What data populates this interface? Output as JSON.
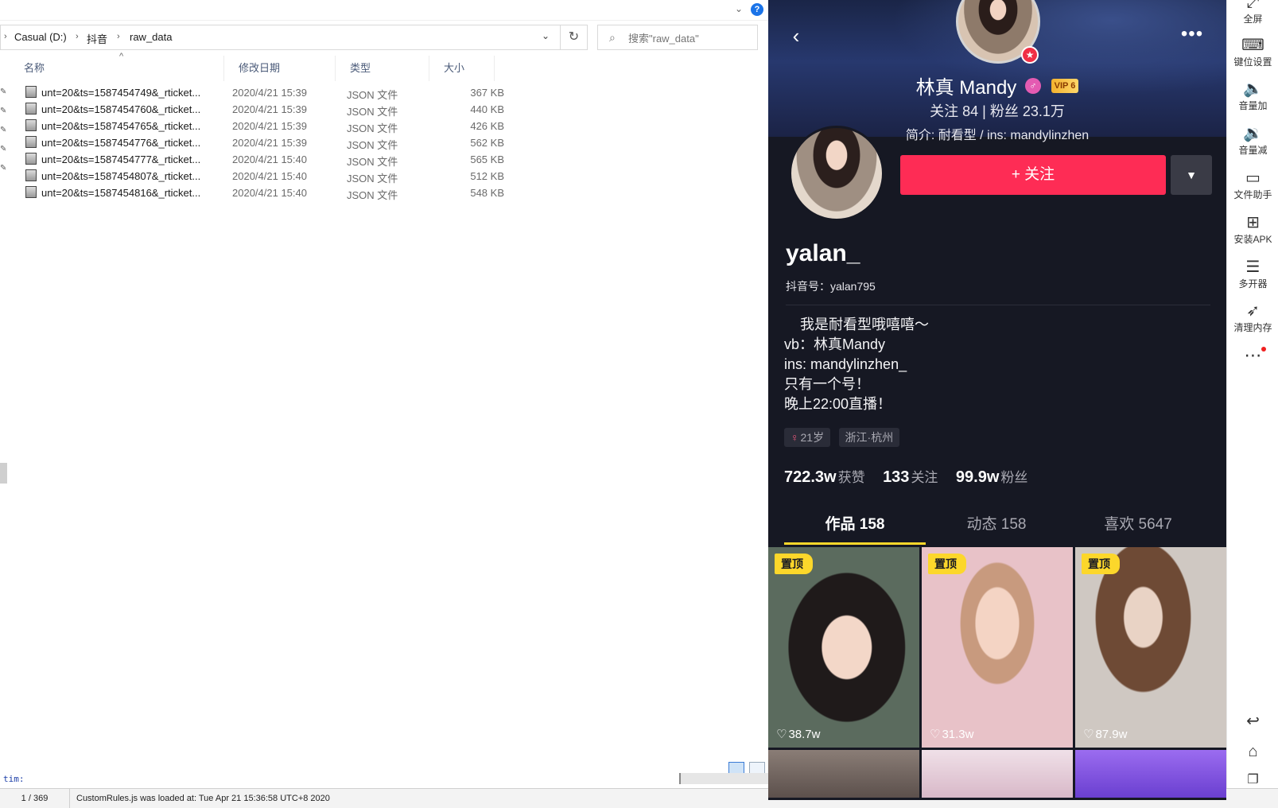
{
  "explorer": {
    "breadcrumb": [
      "Casual (D:)",
      "抖音",
      "raw_data"
    ],
    "search_placeholder": "搜索\"raw_data\"",
    "columns": {
      "name": "名称",
      "date": "修改日期",
      "type": "类型",
      "size": "大小"
    },
    "files": [
      {
        "name": "unt=20&ts=1587454749&_rticket...",
        "date": "2020/4/21 15:39",
        "type": "JSON 文件",
        "size": "367 KB"
      },
      {
        "name": "unt=20&ts=1587454760&_rticket...",
        "date": "2020/4/21 15:39",
        "type": "JSON 文件",
        "size": "440 KB"
      },
      {
        "name": "unt=20&ts=1587454765&_rticket...",
        "date": "2020/4/21 15:39",
        "type": "JSON 文件",
        "size": "426 KB"
      },
      {
        "name": "unt=20&ts=1587454776&_rticket...",
        "date": "2020/4/21 15:39",
        "type": "JSON 文件",
        "size": "562 KB"
      },
      {
        "name": "unt=20&ts=1587454777&_rticket...",
        "date": "2020/4/21 15:40",
        "type": "JSON 文件",
        "size": "565 KB"
      },
      {
        "name": "unt=20&ts=1587454807&_rticket...",
        "date": "2020/4/21 15:40",
        "type": "JSON 文件",
        "size": "512 KB"
      },
      {
        "name": "unt=20&ts=1587454816&_rticket...",
        "date": "2020/4/21 15:40",
        "type": "JSON 文件",
        "size": "548 KB"
      }
    ],
    "tim_label": "tim:"
  },
  "status_bar": {
    "count": "1 / 369",
    "message": "CustomRules.js was loaded at: Tue Apr 21 15:36:58 UTC+8 2020"
  },
  "phone": {
    "header": {
      "name": "林真 Mandy",
      "vip": "VIP 6",
      "stats_line": "关注  84   |   粉丝  23.1万",
      "bio_line": "简介: 耐看型 / ins: mandylinzhen"
    },
    "profile": {
      "follow_label": "+ 关注",
      "username": "yalan_",
      "douyin_id": "抖音号：yalan795",
      "bio": "    我是耐看型哦嘻嘻～\nvb：林真Mandy\nins: mandylinzhen_\n只有一个号！\n晚上22:00直播！",
      "tags": {
        "age": "21岁",
        "location": "浙江·杭州"
      },
      "stats": {
        "likes": {
          "num": "722.3w",
          "label": "获赞"
        },
        "following": {
          "num": "133",
          "label": "关注"
        },
        "followers": {
          "num": "99.9w",
          "label": "粉丝"
        }
      },
      "tabs": [
        "作品 158",
        "动态 158",
        "喜欢 5647"
      ]
    },
    "videos": [
      {
        "pin": "置顶",
        "likes": "38.7w"
      },
      {
        "pin": "置顶",
        "likes": "31.3w"
      },
      {
        "pin": "置顶",
        "likes": "87.9w"
      }
    ],
    "accent_colors": {
      "follow": "#fe2c55",
      "tab_underline": "#fcd72b",
      "background": "#161823"
    }
  },
  "toolbar": {
    "items": [
      {
        "icon": "fullscreen-icon",
        "label": "全屏"
      },
      {
        "icon": "keyboard-icon",
        "label": "键位设置"
      },
      {
        "icon": "volume-up-icon",
        "label": "音量加"
      },
      {
        "icon": "volume-down-icon",
        "label": "音量减"
      },
      {
        "icon": "file-assistant-icon",
        "label": "文件助手"
      },
      {
        "icon": "install-apk-icon",
        "label": "安装APK"
      },
      {
        "icon": "multi-instance-icon",
        "label": "多开器"
      },
      {
        "icon": "rocket-icon",
        "label": "清理内存"
      }
    ]
  }
}
